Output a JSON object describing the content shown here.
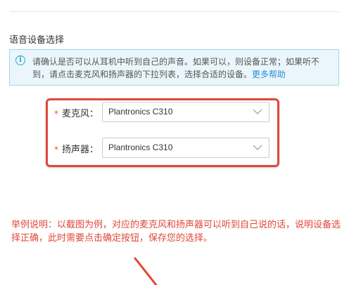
{
  "section": {
    "title": "语音设备选择"
  },
  "info": {
    "text": "请确认是否可以从耳机中听到自己的声音。如果可以，则设备正常；如果听不到，请点击麦克风和扬声器的下拉列表，选择合适的设备。",
    "link": "更多帮助",
    "icon": "info-icon"
  },
  "form": {
    "required_mark": "*",
    "microphone": {
      "label": "麦克风：",
      "value": "Plantronics C310"
    },
    "speaker": {
      "label": "扬声器：",
      "value": "Plantronics C310"
    }
  },
  "annotation": {
    "note": "举例说明：以截图为例，对应的麦克风和扬声器可以听到自己说的话，说明设备选择正确，此时需要点击确定按钮，保存您的选择。"
  },
  "colors": {
    "accent": "#2b8fd8",
    "annotation_red": "#e0473a",
    "info_bg": "#eaf6fb"
  }
}
